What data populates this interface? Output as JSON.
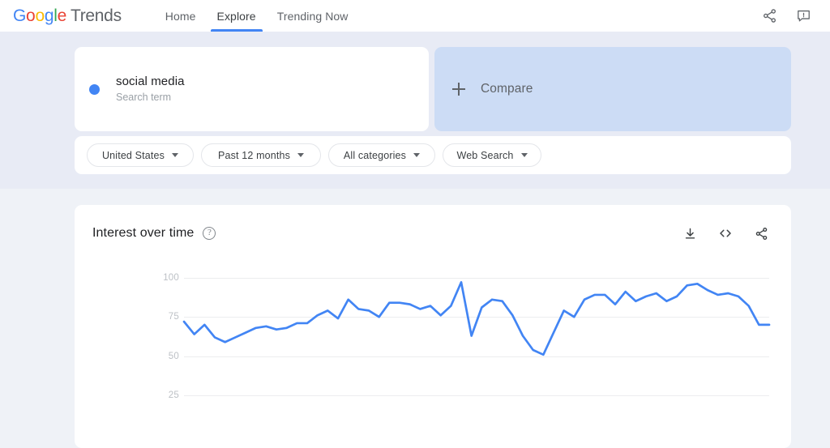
{
  "header": {
    "brand": {
      "google": "Google",
      "product": "Trends"
    },
    "tabs": [
      {
        "label": "Home",
        "active": false
      },
      {
        "label": "Explore",
        "active": true
      },
      {
        "label": "Trending Now",
        "active": false
      }
    ],
    "actions": [
      {
        "name": "share-icon",
        "label": "Share"
      },
      {
        "name": "feedback-icon",
        "label": "Send feedback"
      }
    ]
  },
  "search_terms": {
    "term": {
      "name": "social media",
      "type": "Search term",
      "color": "#4285f4"
    },
    "compare_label": "Compare"
  },
  "filters": [
    {
      "label": "United States"
    },
    {
      "label": "Past 12 months"
    },
    {
      "label": "All categories"
    },
    {
      "label": "Web Search"
    }
  ],
  "chart_panel": {
    "title": "Interest over time",
    "help_label": "?",
    "actions": [
      {
        "name": "download-icon",
        "label": "Download CSV"
      },
      {
        "name": "embed-icon",
        "label": "Embed"
      },
      {
        "name": "share-icon",
        "label": "Share"
      }
    ]
  },
  "chart_data": {
    "type": "line",
    "title": "Interest over time",
    "xlabel": "",
    "ylabel": "",
    "ylim": [
      0,
      108
    ],
    "yticks": [
      25,
      50,
      75,
      100
    ],
    "grid": true,
    "legend": false,
    "series": [
      {
        "name": "social media",
        "color": "#4285f4",
        "values": [
          72,
          64,
          70,
          62,
          59,
          62,
          65,
          68,
          69,
          67,
          68,
          71,
          71,
          76,
          79,
          74,
          86,
          80,
          79,
          75,
          84,
          84,
          83,
          80,
          82,
          76,
          82,
          97,
          63,
          81,
          86,
          85,
          76,
          63,
          54,
          51,
          65,
          79,
          75,
          86,
          89,
          89,
          83,
          91,
          85,
          88,
          90,
          85,
          88,
          95,
          96,
          92,
          89,
          90,
          88,
          82,
          70,
          70
        ]
      }
    ]
  }
}
